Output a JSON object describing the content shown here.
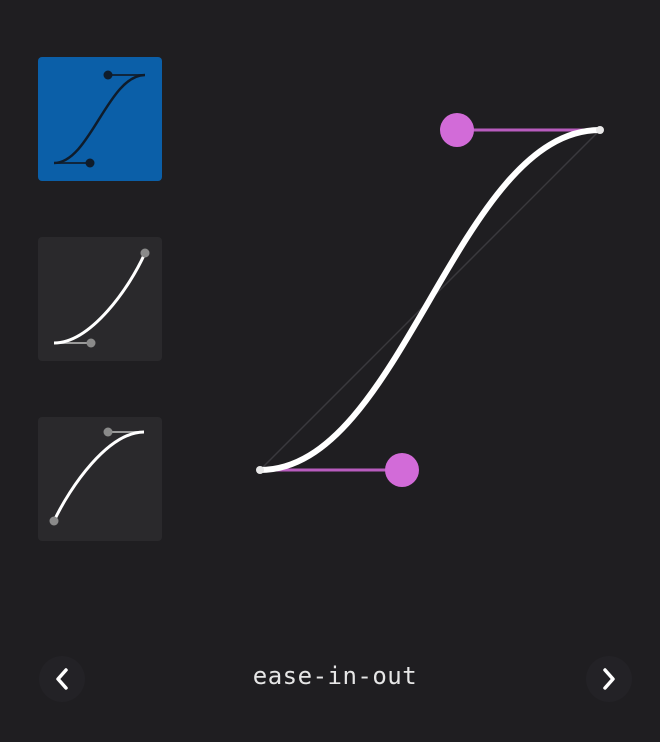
{
  "editor": {
    "easing_name": "ease-in-out",
    "accent_color": "#d26bd8",
    "curve_color": "#ffffff"
  },
  "presets": [
    {
      "icon": "ease-in-out-curve-icon",
      "selected": true
    },
    {
      "icon": "ease-in-curve-icon",
      "selected": false
    },
    {
      "icon": "ease-out-curve-icon",
      "selected": false
    }
  ],
  "navigation": {
    "prev_icon": "chevron-left-icon",
    "next_icon": "chevron-right-icon"
  },
  "colors": {
    "background": "#1f1e21",
    "selected_preset": "#0b5fa8",
    "preset_tile": "#2a292c"
  }
}
